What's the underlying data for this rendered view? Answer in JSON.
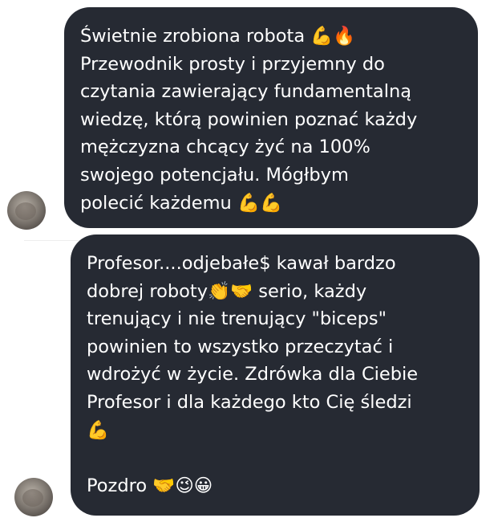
{
  "messages": [
    {
      "lines": [
        "Świetnie zrobiona robota 💪🔥",
        "Przewodnik prosty i przyjemny do",
        "czytania zawierający fundamentalną",
        "wiedzę, którą powinien poznać każdy",
        "mężczyzna chcący żyć na 100%",
        "swojego potencjału. Mógłbym",
        "polecić każdemu 💪💪"
      ]
    },
    {
      "lines": [
        "Profesor....odjebałe$ kawał bardzo",
        "dobrej roboty👏🤝 serio, każdy",
        "trenujący i nie trenujący \"biceps\"",
        "powinien to wszystko przeczytać i",
        "wdrożyć w życie. Zdrówka dla Ciebie",
        "Profesor i dla każdego kto Cię śledzi",
        "💪",
        "",
        "Pozdro 🤝😉😀"
      ]
    }
  ],
  "colors": {
    "bubble_background": "#262a33",
    "bubble_text": "#ffffff",
    "page_background": "#ffffff"
  }
}
